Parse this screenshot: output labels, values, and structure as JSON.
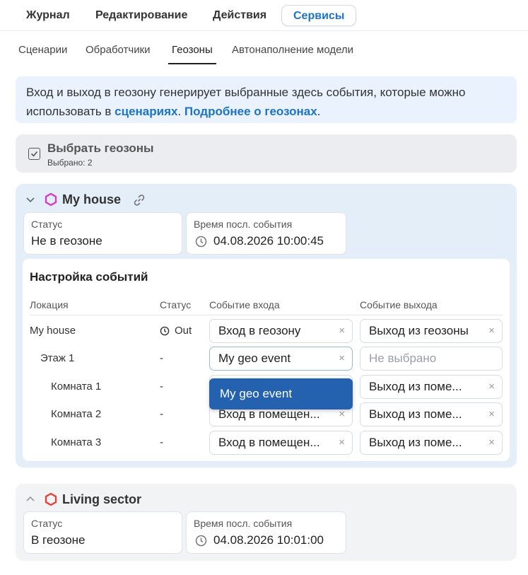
{
  "top_tabs": [
    {
      "label": "Журнал",
      "active": false
    },
    {
      "label": "Редактирование",
      "active": false
    },
    {
      "label": "Действия",
      "active": false
    },
    {
      "label": "Сервисы",
      "active": true
    }
  ],
  "sub_tabs": [
    {
      "label": "Сценарии",
      "active": false
    },
    {
      "label": "Обработчики",
      "active": false
    },
    {
      "label": "Геозоны",
      "active": true
    },
    {
      "label": "Автонаполнение модели",
      "active": false
    }
  ],
  "info": {
    "text1": "Вход и выход в геозону генерирует выбранные здесь события, которые можно использовать в ",
    "link1": "сценариях",
    "text2": ". ",
    "link2": "Подробнее о геозонах",
    "text3": "."
  },
  "select_geozones": {
    "title": "Выбрать геозоны",
    "subtitle": "Выбрано: 2"
  },
  "geozone1": {
    "name": "My house",
    "hex_color": "#d63bc0",
    "status_label": "Статус",
    "status_value": "Не в геозоне",
    "time_label": "Время посл. события",
    "time_value": "04.08.2026 10:00:45",
    "events": {
      "title": "Настройка событий",
      "columns": [
        "Локация",
        "Статус",
        "Событие входа",
        "Событие выхода"
      ],
      "rows": [
        {
          "location": "My house",
          "status": "Out",
          "enter": "Вход в геозону",
          "exit": "Выход из геозоны"
        },
        {
          "location": "Этаж 1",
          "status": "-",
          "enter": "My geo event",
          "exit": "Не выбрано"
        },
        {
          "location": "Комната 1",
          "status": "-",
          "enter": "",
          "exit": "Выход из поме..."
        },
        {
          "location": "Комната 2",
          "status": "-",
          "enter": "Вход в помещен...",
          "exit": "Выход из поме..."
        },
        {
          "location": "Комната 3",
          "status": "-",
          "enter": "Вход в помещен...",
          "exit": "Выход из поме..."
        }
      ],
      "dropdown_option": "My geo event"
    }
  },
  "geozone2": {
    "name": "Living sector",
    "hex_color": "#e0443a",
    "status_label": "Статус",
    "status_value": "В геозоне",
    "time_label": "Время посл. события",
    "time_value": "04.08.2026 10:01:00"
  },
  "icons": {
    "clear": "×"
  },
  "colors": {
    "accent": "#1c73c7",
    "dropdown": "#2462b0",
    "card_active": "#e4eef9"
  }
}
